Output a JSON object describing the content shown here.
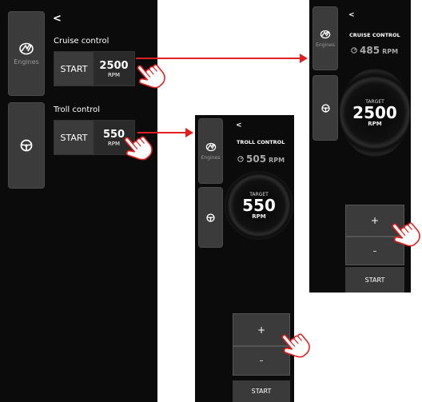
{
  "left_screen": {
    "back": "<",
    "nav": {
      "engines_label": "Engines"
    },
    "cruise": {
      "title": "Cruise control",
      "start": "START",
      "value": "2500",
      "unit": "RPM"
    },
    "troll": {
      "title": "Troll control",
      "start": "START",
      "value": "550",
      "unit": "RPM"
    }
  },
  "troll_screen": {
    "back": "<",
    "engines_label": "Engines",
    "title": "TROLL CONTROL",
    "current_value": "505",
    "current_unit": "RPM",
    "target_label": "TARGET",
    "target_value": "550",
    "target_unit": "RPM",
    "plus": "+",
    "minus": "–",
    "start": "START"
  },
  "cruise_screen": {
    "back": "<",
    "engines_label": "Engines",
    "title": "CRUISE CONTROL",
    "current_value": "485",
    "current_unit": "RPM",
    "target_label": "TARGET",
    "target_value": "2500",
    "target_unit": "RPM",
    "plus": "+",
    "minus": "–",
    "start": "START"
  },
  "colors": {
    "panel": "#0b0b0b",
    "tile": "#3b3b3b",
    "arrow": "#e02020",
    "text": "#ffffff"
  },
  "icons": [
    "mercury-logo-icon",
    "steering-wheel-icon",
    "speedometer-icon",
    "pointing-hand-icon",
    "arrow-right-icon"
  ]
}
